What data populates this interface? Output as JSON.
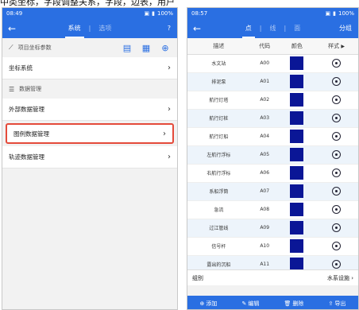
{
  "caption": "中类坐标，字段调整关系，字段，边表，用户",
  "left": {
    "status": {
      "time": "08:49",
      "right": "100%"
    },
    "tabs": [
      "系统",
      "选项"
    ],
    "tab_sep": "|",
    "help": "?",
    "section1": "项目坐标参数",
    "row1": "坐标系统",
    "section2": "数据管理",
    "rows": [
      "外部数据管理",
      "图例数据管理",
      "轨迹数据管理"
    ]
  },
  "right": {
    "status": {
      "time": "08:57",
      "right": "100%"
    },
    "tabs": [
      "点",
      "线",
      "面"
    ],
    "tab_sep": "|",
    "action": "分组",
    "headers": [
      "描述",
      "代码",
      "颜色",
      "样式"
    ],
    "rows": [
      {
        "desc": "水文站",
        "code": "A00"
      },
      {
        "desc": "排泥泵",
        "code": "A01"
      },
      {
        "desc": "航行灯塔",
        "code": "A02"
      },
      {
        "desc": "航行灯桩",
        "code": "A03"
      },
      {
        "desc": "航行灯船",
        "code": "A04"
      },
      {
        "desc": "左航行浮标",
        "code": "A05"
      },
      {
        "desc": "右航行浮标",
        "code": "A06"
      },
      {
        "desc": "系船浮筒",
        "code": "A07"
      },
      {
        "desc": "急流",
        "code": "A08"
      },
      {
        "desc": "过江管线",
        "code": "A09"
      },
      {
        "desc": "信号杆",
        "code": "A10"
      },
      {
        "desc": "露出的沉船",
        "code": "A11"
      }
    ],
    "footer_left": "组别",
    "footer_right": "水系设施",
    "buttons": [
      "添加",
      "编辑",
      "删除",
      "导出"
    ],
    "colors": {
      "swatch": "#0a1696",
      "accent": "#2a6fe2"
    }
  }
}
